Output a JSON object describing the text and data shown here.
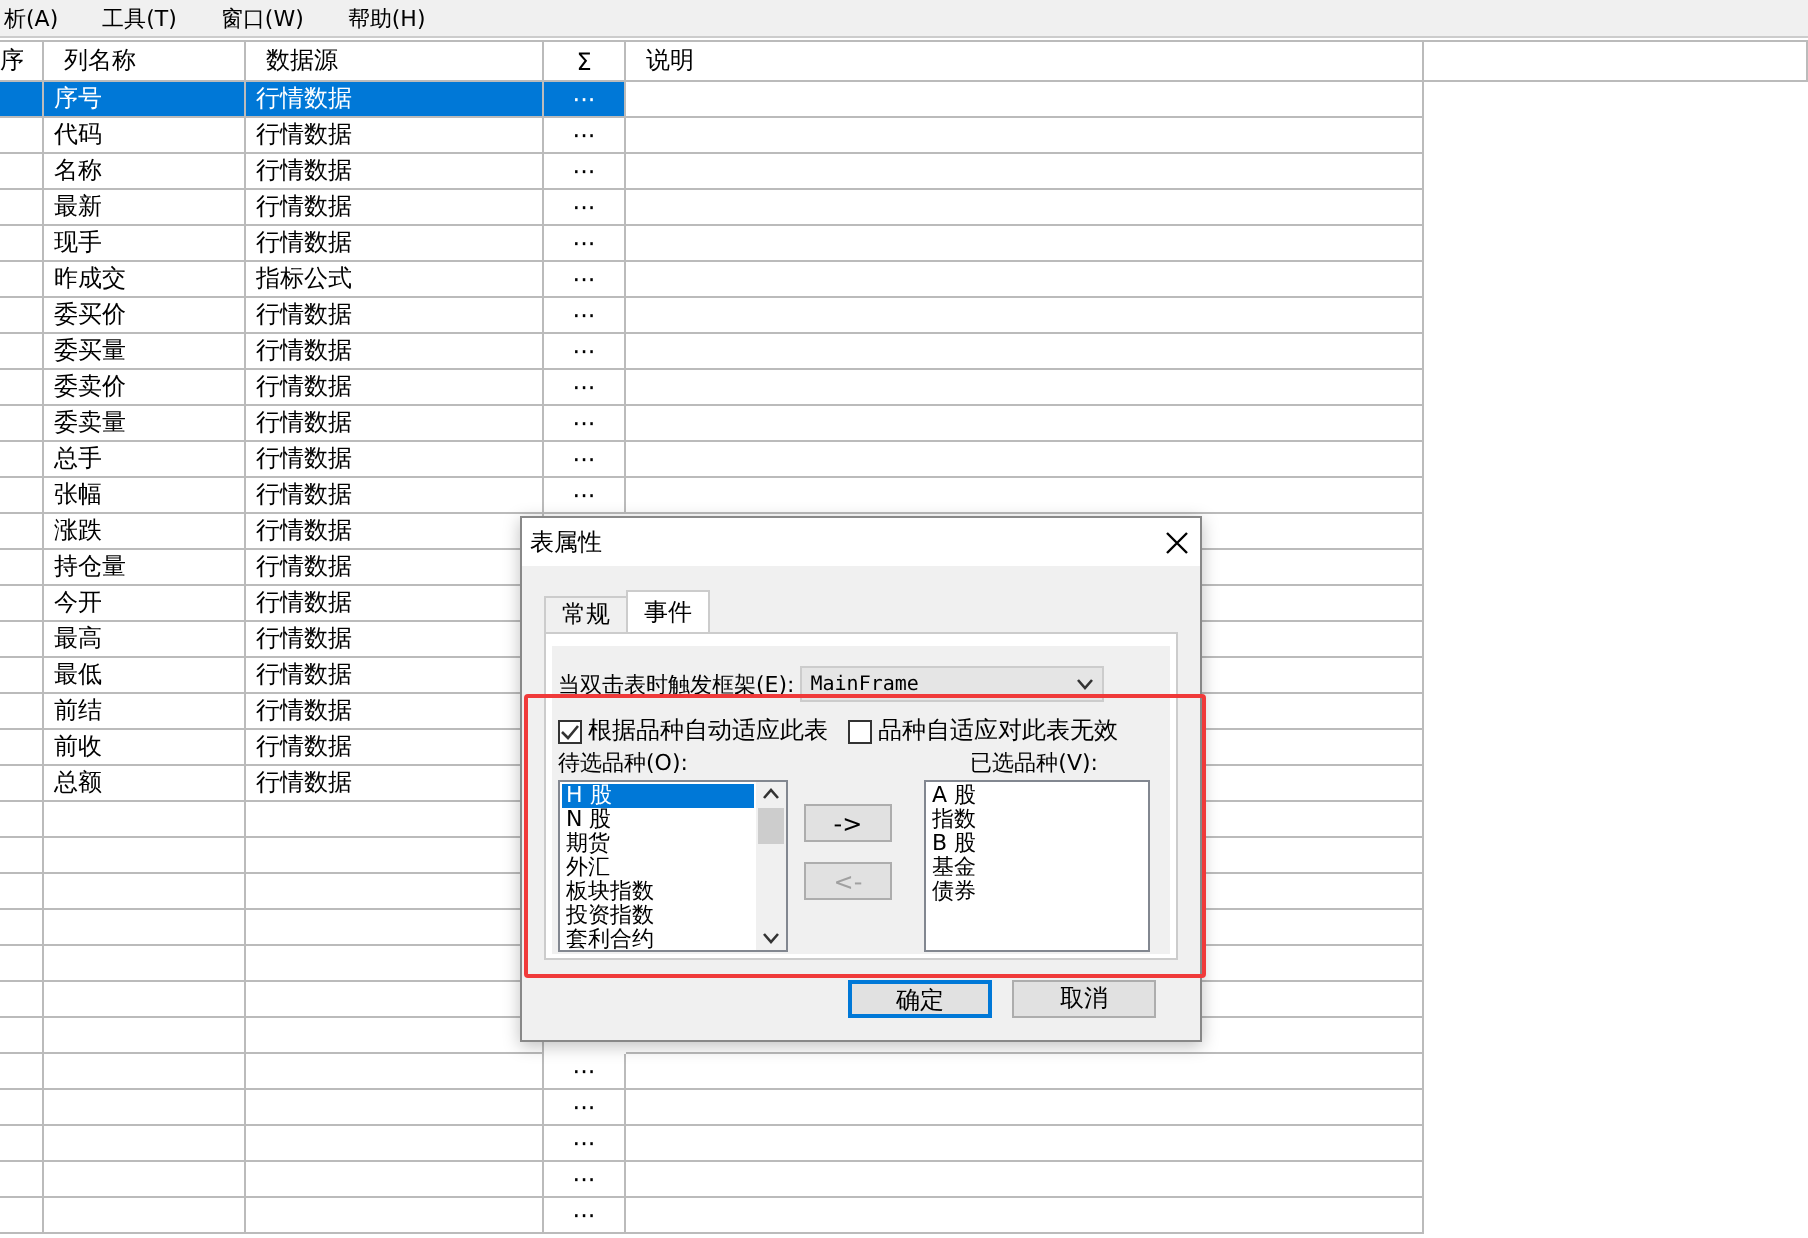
{
  "menu": [
    "析(A)",
    "工具(T)",
    "窗口(W)",
    "帮助(H)"
  ],
  "table": {
    "columns": [
      "序",
      "列名称",
      "数据源",
      "Σ",
      "说明"
    ],
    "rows": [
      {
        "name": "序号",
        "source": "行情数据",
        "sigma": "···",
        "selected": true
      },
      {
        "name": "代码",
        "source": "行情数据",
        "sigma": "···",
        "selected": false
      },
      {
        "name": "名称",
        "source": "行情数据",
        "sigma": "···",
        "selected": false
      },
      {
        "name": "最新",
        "source": "行情数据",
        "sigma": "···",
        "selected": false
      },
      {
        "name": "现手",
        "source": "行情数据",
        "sigma": "···",
        "selected": false
      },
      {
        "name": "昨成交",
        "source": "指标公式",
        "sigma": "···",
        "selected": false
      },
      {
        "name": "委买价",
        "source": "行情数据",
        "sigma": "···",
        "selected": false
      },
      {
        "name": "委买量",
        "source": "行情数据",
        "sigma": "···",
        "selected": false
      },
      {
        "name": "委卖价",
        "source": "行情数据",
        "sigma": "···",
        "selected": false
      },
      {
        "name": "委卖量",
        "source": "行情数据",
        "sigma": "···",
        "selected": false
      },
      {
        "name": "总手",
        "source": "行情数据",
        "sigma": "···",
        "selected": false
      },
      {
        "name": "张幅",
        "source": "行情数据",
        "sigma": "···",
        "selected": false
      },
      {
        "name": "涨跌",
        "source": "行情数据",
        "selected": false
      },
      {
        "name": "持仓量",
        "source": "行情数据",
        "selected": false
      },
      {
        "name": "今开",
        "source": "行情数据",
        "selected": false
      },
      {
        "name": "最高",
        "source": "行情数据",
        "selected": false
      },
      {
        "name": "最低",
        "source": "行情数据",
        "selected": false
      },
      {
        "name": "前结",
        "source": "行情数据",
        "selected": false
      },
      {
        "name": "前收",
        "source": "行情数据",
        "selected": false
      },
      {
        "name": "总额",
        "source": "行情数据",
        "selected": false
      },
      {
        "selected": false
      },
      {
        "selected": false
      },
      {
        "selected": false
      },
      {
        "selected": false
      },
      {
        "selected": false
      },
      {
        "selected": false
      },
      {
        "selected": false
      },
      {
        "sigma": "···",
        "selected": false
      },
      {
        "sigma": "···",
        "selected": false
      },
      {
        "sigma": "···",
        "selected": false
      },
      {
        "sigma": "···",
        "selected": false
      },
      {
        "sigma": "···",
        "selected": false
      }
    ]
  },
  "dialog": {
    "title": "表属性",
    "tabs": [
      {
        "label": "常规",
        "selected": false
      },
      {
        "label": "事件",
        "selected": true
      }
    ],
    "frame_label": "当双击表时触发框架(E):",
    "frame_value": "MainFrame",
    "checkboxes": [
      {
        "label": "根据品种自动适应此表",
        "checked": true
      },
      {
        "label": "品种自适应对此表无效",
        "checked": false
      }
    ],
    "available_label": "待选品种(O):",
    "available": [
      {
        "label": "H 股",
        "selected": true
      },
      {
        "label": "N 股",
        "selected": false
      },
      {
        "label": "期货",
        "selected": false
      },
      {
        "label": "外汇",
        "selected": false
      },
      {
        "label": "板块指数",
        "selected": false
      },
      {
        "label": "投资指数",
        "selected": false
      },
      {
        "label": "套利合约",
        "selected": false
      }
    ],
    "chosen_label": "已选品种(V):",
    "chosen": [
      "A 股",
      "指数",
      "B 股",
      "基金",
      "债券"
    ],
    "move_buttons": [
      {
        "label": "->",
        "disabled": false
      },
      {
        "label": "<-",
        "disabled": true
      }
    ],
    "buttons": [
      {
        "label": "确定",
        "default": true
      },
      {
        "label": "取消",
        "default": false
      }
    ]
  }
}
